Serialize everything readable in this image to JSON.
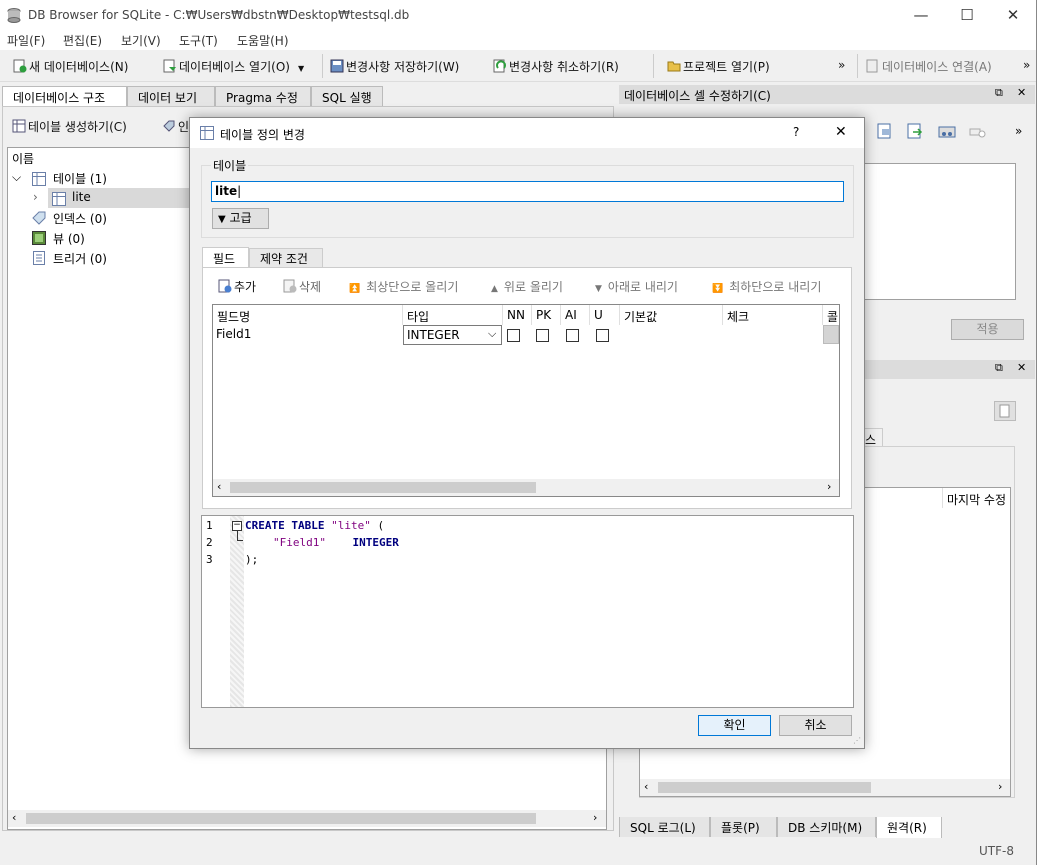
{
  "window": {
    "title": "DB Browser for SQLite - C:₩Users₩dbstn₩Desktop₩testsql.db",
    "min": "—",
    "max": "☐",
    "close": "✕"
  },
  "menu": [
    "파일(F)",
    "편집(E)",
    "보기(V)",
    "도구(T)",
    "도움말(H)"
  ],
  "toolbar": {
    "new_db": "새 데이터베이스(N)",
    "open_db": "데이터베이스 열기(O)",
    "write": "변경사항 저장하기(W)",
    "revert": "변경사항 취소하기(R)",
    "open_project": "프로젝트 열기(P)",
    "more": "»",
    "attach": "데이터베이스 연결(A)",
    "more2": "»"
  },
  "main_tabs": [
    "데이터베이스 구조",
    "데이터 보기",
    "Pragma 수정",
    "SQL 실행"
  ],
  "structure": {
    "create_table": "테이블 생성하기(C)",
    "create_index_partial": "인",
    "header_name": "이름",
    "tables": "테이블 (1)",
    "table_lite": "lite",
    "indexes": "인덱스 (0)",
    "views": "뷰 (0)",
    "triggers": "트리거 (0)"
  },
  "right": {
    "cell_edit_title": "데이터베이스 셀 수정하기(C)",
    "apply": "적용",
    "more": "»",
    "schema_tab_partial": "스",
    "last_modified": "마지막 수정",
    "float": "⧉",
    "close": "✕"
  },
  "bottom_tabs": [
    "SQL 로그(L)",
    "플롯(P)",
    "DB 스키마(M)",
    "원격(R)"
  ],
  "status": {
    "encoding": "UTF-8"
  },
  "dialog": {
    "title": "테이블 정의 변경",
    "help": "?",
    "close": "✕",
    "table_group": "테이블",
    "table_name": "lite",
    "advanced": "고급",
    "tabs": [
      "필드",
      "제약 조건"
    ],
    "actions": {
      "add": "추가",
      "remove": "삭제",
      "move_top": "최상단으로 올리기",
      "move_up": "위로 올리기",
      "move_down": "아래로 내리기",
      "move_bottom": "최하단으로 내리기"
    },
    "columns": [
      "필드명",
      "타입",
      "NN",
      "PK",
      "AI",
      "U",
      "기본값",
      "체크",
      "콜"
    ],
    "fields": [
      {
        "name": "Field1",
        "type": "INTEGER",
        "nn": false,
        "pk": false,
        "ai": false,
        "u": false
      }
    ],
    "sql_lines": [
      "1",
      "2",
      "3"
    ],
    "sql": {
      "l1_kw": "CREATE TABLE",
      "l1_name": "\"lite\"",
      "l1_rest": " (",
      "l2_name": "\"Field1\"",
      "l2_type": "INTEGER",
      "l3": ");"
    },
    "ok": "확인",
    "cancel": "취소"
  }
}
